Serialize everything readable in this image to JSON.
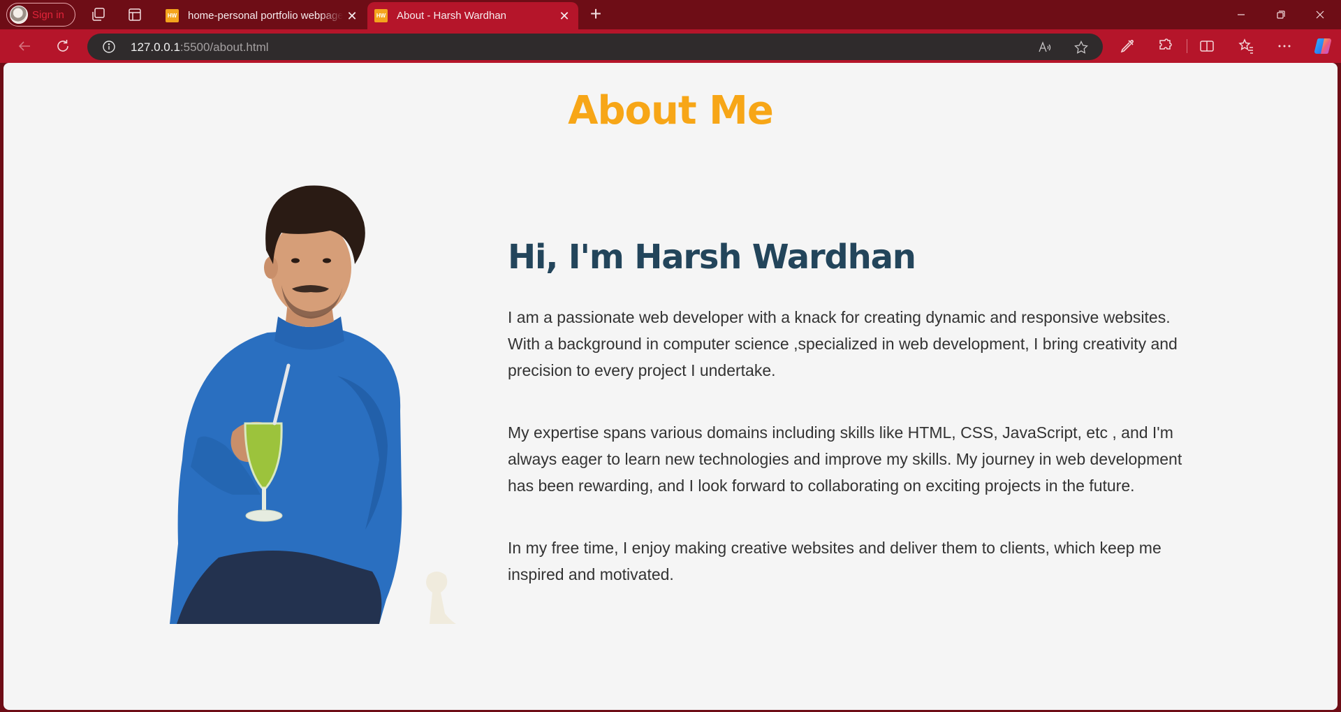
{
  "browser": {
    "profile": {
      "signin_label": "Sign in"
    },
    "tabs": [
      {
        "favicon_text": "HW",
        "title": "home-personal portfolio webpage",
        "active": false
      },
      {
        "favicon_text": "HW",
        "title": "About - Harsh Wardhan",
        "active": true
      }
    ],
    "address": {
      "host": "127.0.0.1",
      "path": ":5500/about.html"
    },
    "colors": {
      "frame": "#6e0d16",
      "toolbar": "#b5152a",
      "address_bar": "#2f2b2c"
    }
  },
  "page": {
    "title": "About Me",
    "greeting": "Hi, I'm Harsh Wardhan",
    "paragraphs": [
      "I am a passionate web developer with a knack for creating dynamic and responsive websites. With a background in computer science ,specialized in web development, I bring creativity and precision to every project I undertake.",
      "My expertise spans various domains including skills like HTML, CSS, JavaScript, etc , and I'm always eager to learn new technologies and improve my skills. My journey in web development has been rewarding, and I look forward to collaborating on exciting projects in the future.",
      "In my free time, I enjoy making creative websites and deliver them to clients, which keep me inspired and motivated."
    ],
    "colors": {
      "title": "#f7a617",
      "greeting": "#23455b",
      "text": "#333333",
      "background": "#f5f5f5"
    }
  }
}
